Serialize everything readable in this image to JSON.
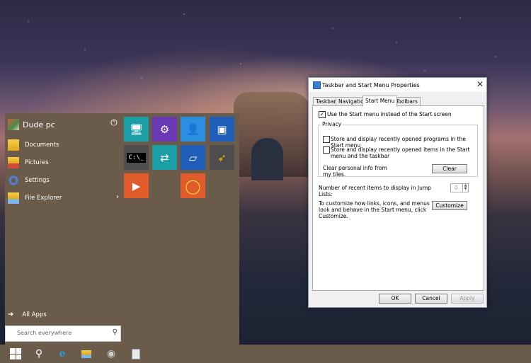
{
  "start_menu": {
    "user_name": "Dude pc",
    "items": [
      {
        "label": "Documents"
      },
      {
        "label": "Pictures"
      },
      {
        "label": "Settings"
      },
      {
        "label": "File Explorer"
      }
    ],
    "all_apps": "All Apps",
    "search_placeholder": "Search everywhere"
  },
  "tiles": [
    {
      "icon": "computer-icon",
      "color": "#1a9fa6"
    },
    {
      "icon": "settings-gear-icon",
      "color": "#6a39b5"
    },
    {
      "icon": "users-icon",
      "color": "#2b8ee0"
    },
    {
      "icon": "control-panel-icon",
      "color": "#1e5eb8"
    },
    {
      "icon": "command-prompt-icon",
      "color": "#4d4d4d"
    },
    {
      "icon": "network-icon",
      "color": "#1a9fa6"
    },
    {
      "icon": "display-icon",
      "color": "#1e5eb8"
    },
    {
      "icon": "tool-icon",
      "color": "#4d4d4d"
    },
    {
      "icon": "media-player-icon",
      "color": "#e05a2a"
    },
    {
      "icon": "ring-icon",
      "color": "#e05a2a"
    }
  ],
  "dialog": {
    "title": "Taskbar and Start Menu Properties",
    "tabs": [
      "Taskbar",
      "Navigation",
      "Start Menu",
      "Toolbars"
    ],
    "active_tab": "Start Menu",
    "use_start_menu": "Use the Start menu instead of the Start screen",
    "privacy_label": "Privacy",
    "store_programs": "Store and display recently opened programs in the Start menu",
    "store_items": "Store and display recently opened items in the Start menu and the taskbar",
    "clear_info": "Clear personal info from my tiles.",
    "clear_button": "Clear",
    "jumplist_label": "Number of recent items to display in Jump Lists:",
    "jumplist_value": "0",
    "customize_text": "To customize how links, icons, and menus look and behave in the Start menu, click Customize.",
    "customize_button": "Customize",
    "ok": "OK",
    "cancel": "Cancel",
    "apply": "Apply"
  },
  "taskbar": {
    "icons": [
      "windows-start-icon",
      "search-icon",
      "internet-explorer-icon",
      "file-explorer-icon",
      "remote-desktop-icon",
      "properties-icon"
    ]
  }
}
